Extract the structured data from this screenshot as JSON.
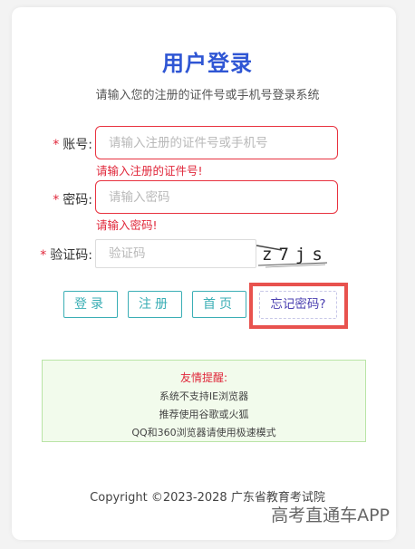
{
  "page": {
    "title": "用户登录",
    "subtitle": "请输入您的注册的证件号或手机号登录系统"
  },
  "form": {
    "account": {
      "required_mark": "*",
      "label": "账号:",
      "placeholder": "请输入注册的证件号或手机号",
      "value": "",
      "error": "请输入注册的证件号!"
    },
    "password": {
      "required_mark": "*",
      "label": "密码:",
      "placeholder": "请输入密码",
      "value": "",
      "error": "请输入密码!"
    },
    "captcha": {
      "required_mark": "*",
      "label": "验证码:",
      "placeholder": "验证码",
      "value": "",
      "image_text": "z7js"
    }
  },
  "buttons": {
    "login": "登录",
    "register": "注册",
    "home": "首页",
    "forgot": "忘记密码?"
  },
  "notice": {
    "title": "友情提醒:",
    "lines": [
      "系统不支持IE浏览器",
      "推荐使用谷歌或火狐",
      "QQ和360浏览器请使用极速模式"
    ]
  },
  "footer": {
    "copyright": "Copyright ©2023-2028 广东省教育考试院"
  },
  "watermark": "高考直通车APP",
  "colors": {
    "title": "#2f56d4",
    "error": "#e0273a",
    "button_teal": "#3aaeb5",
    "highlight": "#e8524e"
  }
}
